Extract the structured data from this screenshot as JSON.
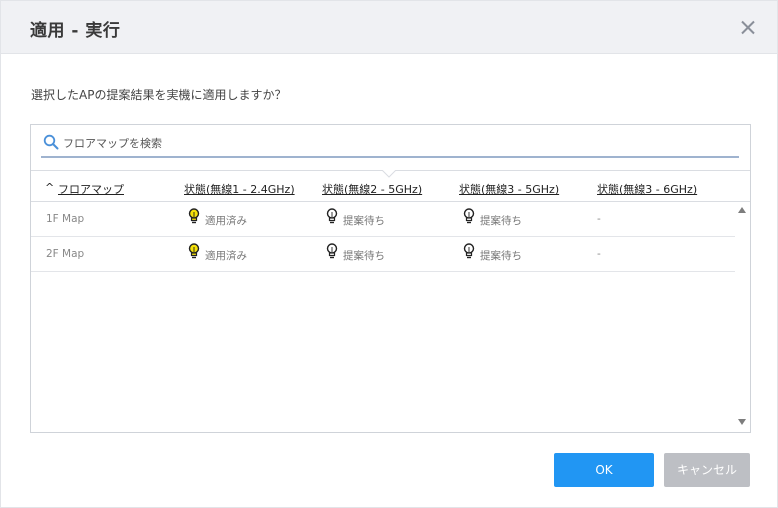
{
  "dialog": {
    "title": "適用 - 実行",
    "close_icon": "close-icon",
    "question": "選択したAPの提案結果を実機に適用しますか？"
  },
  "search": {
    "icon": "search-icon",
    "placeholder": "フロアマップを検索",
    "value": ""
  },
  "table": {
    "sort_indicator": "^",
    "columns": [
      "フロアマップ",
      "状態(無線1 - 2.4GHz)",
      "状態(無線2 - 5GHz)",
      "状態(無線3 - 5GHz)",
      "状態(無線3 - 6GHz)"
    ],
    "rows": [
      {
        "map": "1F Map",
        "radio1": {
          "text": "適用済み",
          "icon": "lightbulb-on-icon"
        },
        "radio2": {
          "text": "提案待ち",
          "icon": "lightbulb-off-icon"
        },
        "radio3_5": {
          "text": "提案待ち",
          "icon": "lightbulb-off-icon"
        },
        "radio3_6": "-"
      },
      {
        "map": "2F Map",
        "radio1": {
          "text": "適用済み",
          "icon": "lightbulb-on-icon"
        },
        "radio2": {
          "text": "提案待ち",
          "icon": "lightbulb-off-icon"
        },
        "radio3_5": {
          "text": "提案待ち",
          "icon": "lightbulb-off-icon"
        },
        "radio3_6": "-"
      }
    ]
  },
  "buttons": {
    "ok": "OK",
    "cancel": "キャンセル"
  },
  "colors": {
    "primary": "#2196f3",
    "disabled": "#bdbfc4",
    "bulb_on": "#f5e10a",
    "bulb_off": "#ffffff",
    "header_bg": "#f0f1f4"
  }
}
